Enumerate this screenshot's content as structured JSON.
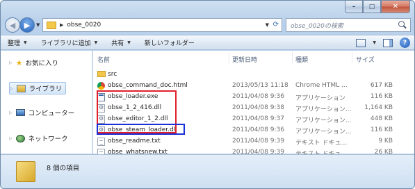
{
  "window": {
    "caption_buttons": [
      "minimize",
      "maximize",
      "close"
    ]
  },
  "address": {
    "path": "obse_0020",
    "search_placeholder": "obse_0020の検索"
  },
  "toolbar": {
    "organize": "整理",
    "add_to_library": "ライブラリに追加",
    "share": "共有",
    "new_folder": "新しいフォルダー"
  },
  "nav": {
    "favorites": "お気に入り",
    "libraries": "ライブラリ",
    "computer": "コンピューター",
    "network": "ネットワーク"
  },
  "columns": {
    "name": "名前",
    "date": "更新日時",
    "type": "種類",
    "size": "サイズ"
  },
  "files": [
    {
      "name": "src",
      "date": "",
      "type": "",
      "size": "",
      "icon": "folder-icon"
    },
    {
      "name": "obse_command_doc.html",
      "date": "2013/05/13 11:18",
      "type": "Chrome HTML ...",
      "size": "617 KB",
      "icon": "chrome-html-icon"
    },
    {
      "name": "obse_loader.exe",
      "date": "2011/04/08 9:36",
      "type": "アプリケーション",
      "size": "116 KB",
      "icon": "exe-icon"
    },
    {
      "name": "obse_1_2_416.dll",
      "date": "2011/04/08 9:38",
      "type": "アプリケーション...",
      "size": "1,164 KB",
      "icon": "dll-icon"
    },
    {
      "name": "obse_editor_1_2.dll",
      "date": "2011/04/08 9:37",
      "type": "アプリケーション...",
      "size": "448 KB",
      "icon": "dll-icon"
    },
    {
      "name": "obse_steam_loader.dll",
      "date": "2011/04/08 9:36",
      "type": "アプリケーション...",
      "size": "116 KB",
      "icon": "dll-icon"
    },
    {
      "name": "obse_readme.txt",
      "date": "2011/04/08 9:39",
      "type": "テキスト ドキュ...",
      "size": "9 KB",
      "icon": "txt-icon"
    },
    {
      "name": "obse_whatsnew.txt",
      "date": "2011/04/08 9:39",
      "type": "テキスト ドキュ...",
      "size": "26 KB",
      "icon": "txt-icon"
    }
  ],
  "status": {
    "item_count": "8 個の項目"
  },
  "annotation_colors": {
    "red_box": "#e0202c",
    "blue_box": "#1a2fd8"
  }
}
